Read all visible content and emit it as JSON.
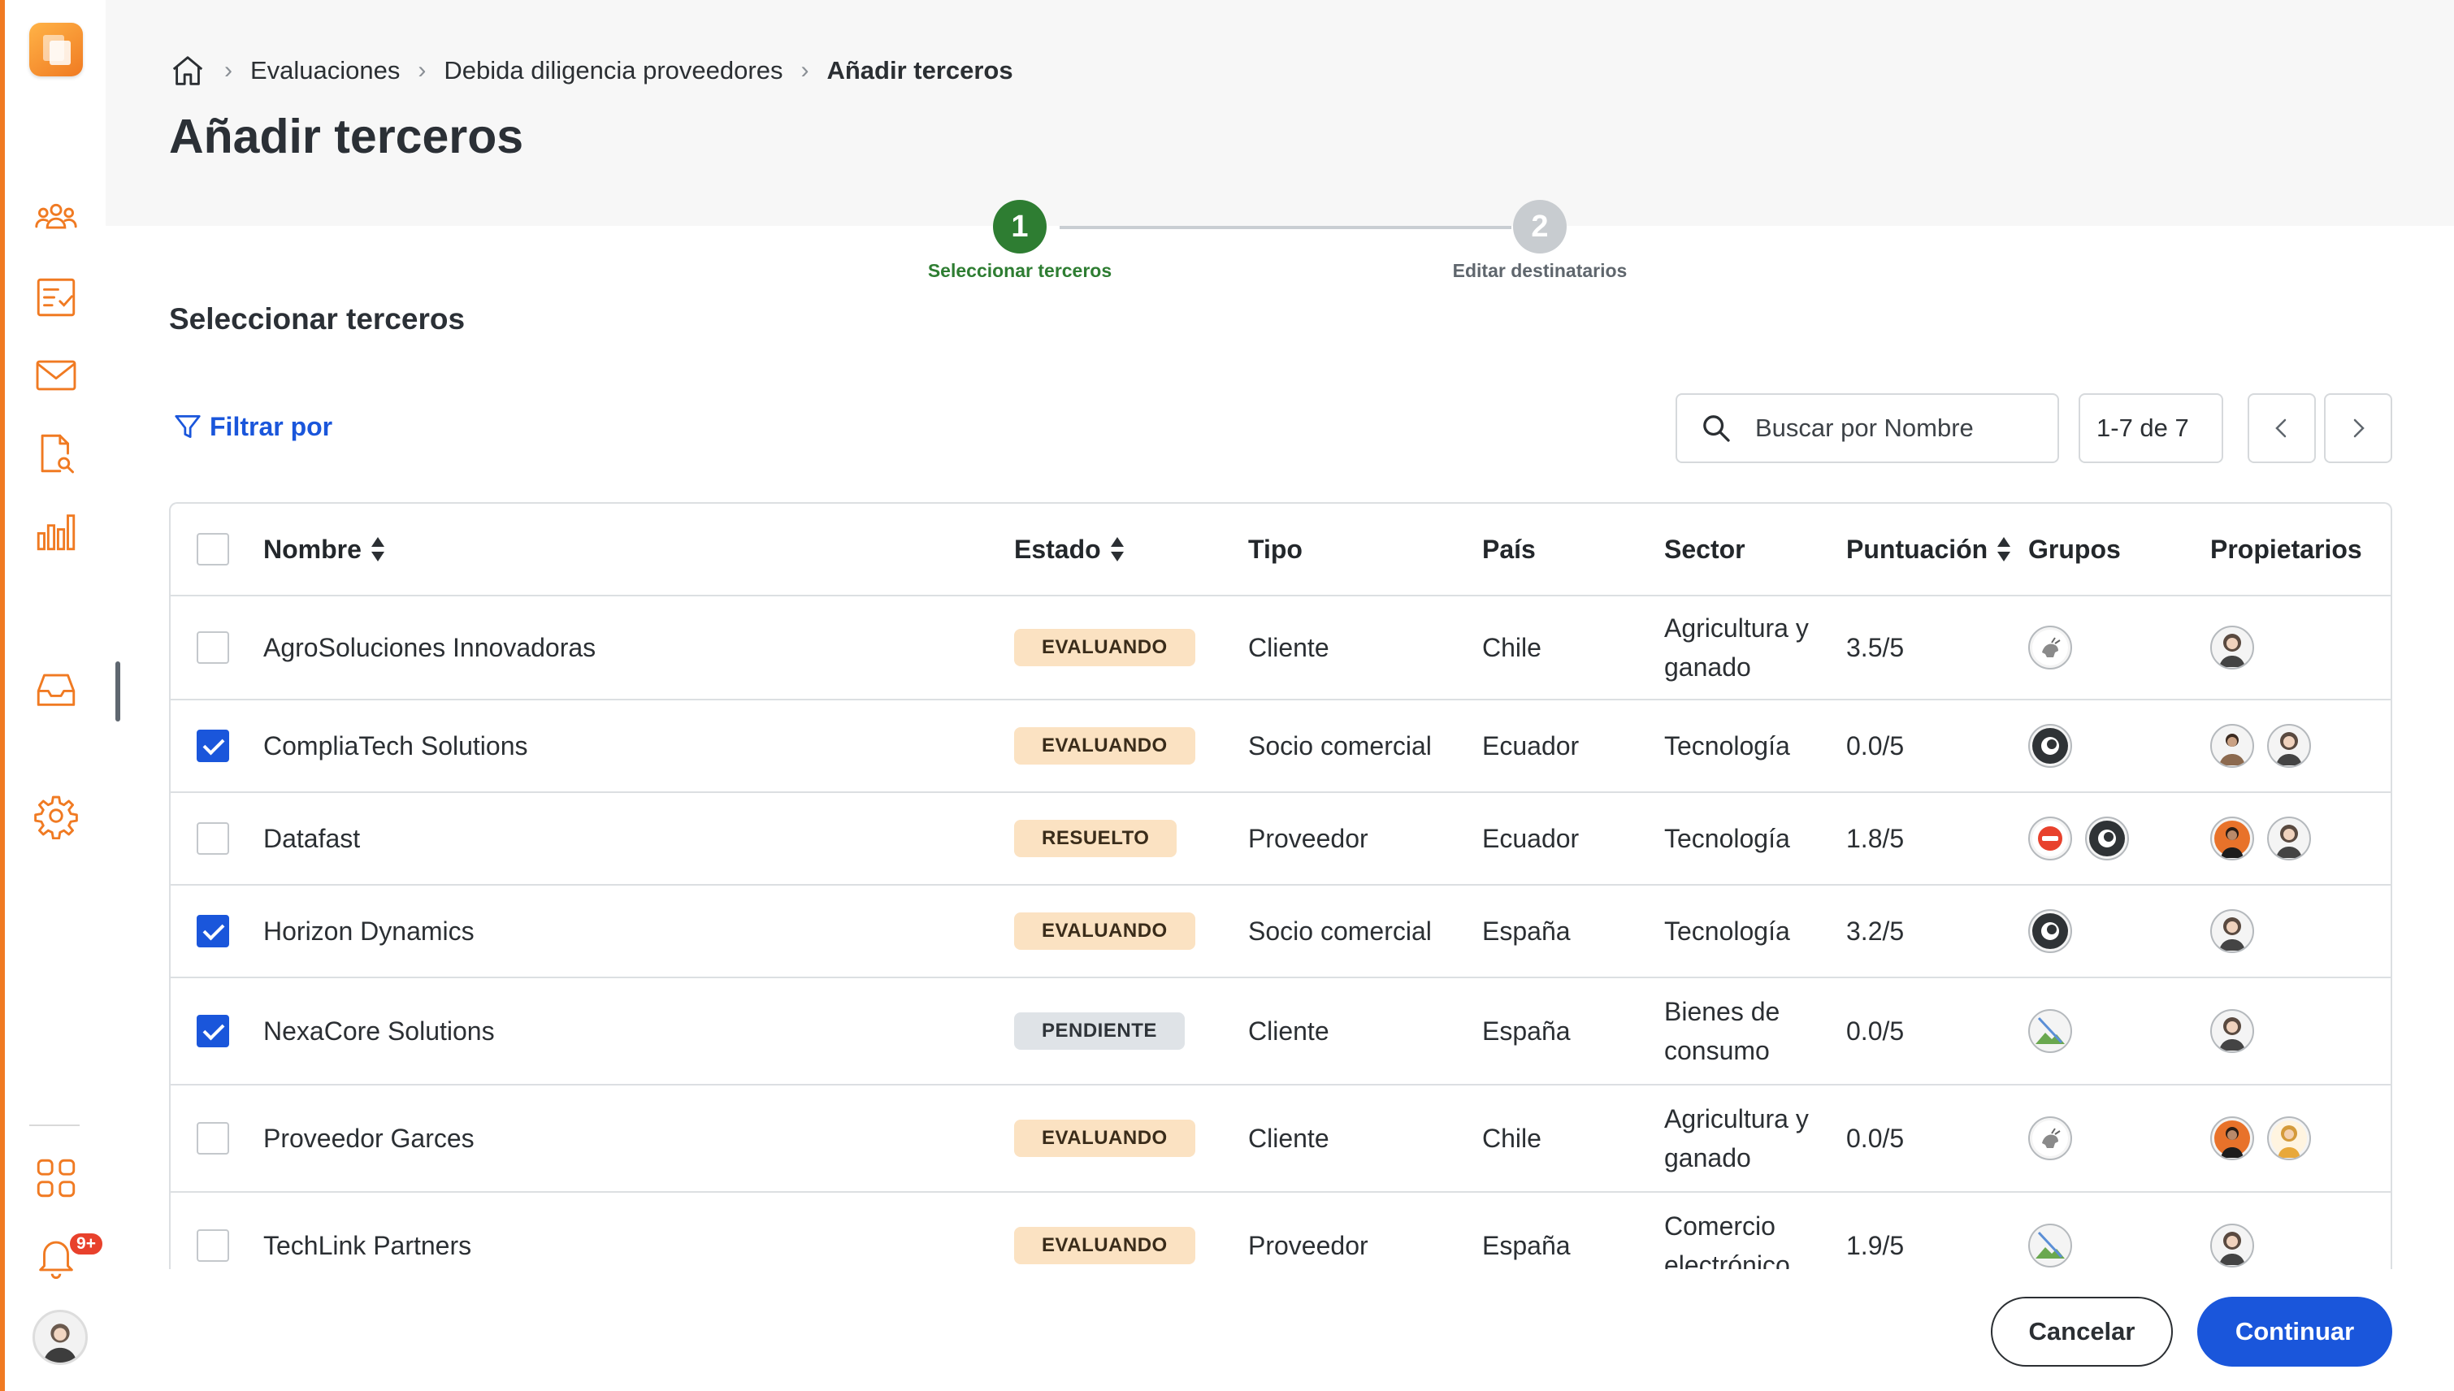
{
  "breadcrumb": {
    "home_icon": "home-icon",
    "items": [
      "Evaluaciones",
      "Debida diligencia proveedores"
    ],
    "current": "Añadir terceros"
  },
  "page_title": "Añadir terceros",
  "stepper": {
    "steps": [
      {
        "number": "1",
        "label": "Seleccionar terceros",
        "status": "active",
        "color": "#2e7d32"
      },
      {
        "number": "2",
        "label": "Editar destinatarios",
        "status": "pending",
        "color": "#c8ccd0"
      }
    ]
  },
  "section_title": "Seleccionar terceros",
  "toolbar": {
    "filter_label": "Filtrar por",
    "search_placeholder": "Buscar por Nombre",
    "page_count": "1-7 de 7"
  },
  "table": {
    "columns": [
      "Nombre",
      "Estado",
      "Tipo",
      "País",
      "Sector",
      "Puntuación",
      "Grupos",
      "Propietarios"
    ],
    "rows": [
      {
        "checked": false,
        "name": "AgroSoluciones Innovadoras",
        "status": "EVALUANDO",
        "status_kind": "evaluando",
        "type": "Cliente",
        "country": "Chile",
        "sector": [
          "Agricultura y",
          "ganado"
        ],
        "score": "3.5/5",
        "groups": [
          "goat-group-icon"
        ],
        "owners": [
          "owner-woman-1"
        ]
      },
      {
        "checked": true,
        "name": "CompliaTech Solutions",
        "status": "EVALUANDO",
        "status_kind": "evaluando",
        "type": "Socio comercial",
        "country": "Ecuador",
        "sector": [
          "Tecnología"
        ],
        "score": "0.0/5",
        "groups": [
          "eye-group-icon"
        ],
        "owners": [
          "owner-man-1",
          "owner-woman-1"
        ]
      },
      {
        "checked": false,
        "name": "Datafast",
        "status": "RESUELTO",
        "status_kind": "resuelto",
        "type": "Proveedor",
        "country": "Ecuador",
        "sector": [
          "Tecnología"
        ],
        "score": "1.8/5",
        "groups": [
          "red-group-icon",
          "eye-group-icon"
        ],
        "owners": [
          "owner-man-2",
          "owner-woman-1"
        ]
      },
      {
        "checked": true,
        "name": "Horizon Dynamics",
        "status": "EVALUANDO",
        "status_kind": "evaluando",
        "type": "Socio comercial",
        "country": "España",
        "sector": [
          "Tecnología"
        ],
        "score": "3.2/5",
        "groups": [
          "eye-group-icon"
        ],
        "owners": [
          "owner-woman-1"
        ]
      },
      {
        "checked": true,
        "name": "NexaCore Solutions",
        "status": "PENDIENTE",
        "status_kind": "pendiente",
        "type": "Cliente",
        "country": "España",
        "sector": [
          "Bienes de",
          "consumo"
        ],
        "score": "0.0/5",
        "groups": [
          "landscape-group-icon"
        ],
        "owners": [
          "owner-woman-1"
        ]
      },
      {
        "checked": false,
        "name": "Proveedor Garces",
        "status": "EVALUANDO",
        "status_kind": "evaluando",
        "type": "Cliente",
        "country": "Chile",
        "sector": [
          "Agricultura y",
          "ganado"
        ],
        "score": "0.0/5",
        "groups": [
          "goat-group-icon"
        ],
        "owners": [
          "owner-man-2",
          "owner-woman-2"
        ]
      },
      {
        "checked": false,
        "name": "TechLink Partners",
        "status": "EVALUANDO",
        "status_kind": "evaluando",
        "type": "Proveedor",
        "country": "España",
        "sector": [
          "Comercio",
          "electrónico"
        ],
        "score": "1.9/5",
        "groups": [
          "landscape-group-icon"
        ],
        "owners": [
          "owner-woman-1"
        ]
      }
    ]
  },
  "sidebar": {
    "icons": [
      "users-icon",
      "checklist-icon",
      "mail-icon",
      "document-search-icon",
      "bar-chart-icon",
      "inbox-icon",
      "gear-icon",
      "apps-grid-icon",
      "bell-icon"
    ],
    "notification_badge": "9+"
  },
  "footer": {
    "cancel_label": "Cancelar",
    "continue_label": "Continuar"
  },
  "colors": {
    "accent": "#f07a22",
    "primary": "#1a56db",
    "step_active": "#2e7d32"
  }
}
